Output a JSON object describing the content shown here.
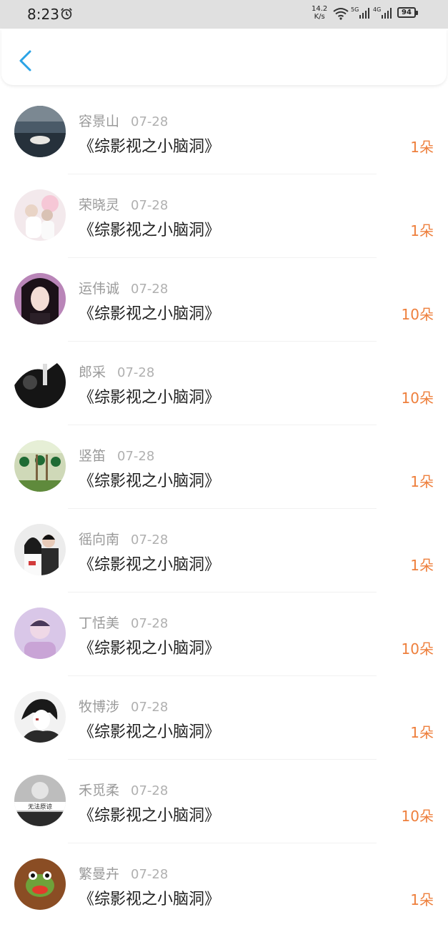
{
  "status_bar": {
    "time": "8:23",
    "net_speed_value": "14.2",
    "net_speed_unit": "K/s",
    "sig1_label": "5G",
    "sig2_label": "4G",
    "battery": "94"
  },
  "colors": {
    "accent": "#2aa3e6",
    "amount": "#ee7f3c",
    "name": "#9a9a9a",
    "title": "#222222"
  },
  "items": [
    {
      "name": "容景山",
      "date": "07-28",
      "title": "《综影视之小脑洞》",
      "amount": "1朵"
    },
    {
      "name": "荣晓灵",
      "date": "07-28",
      "title": "《综影视之小脑洞》",
      "amount": "1朵"
    },
    {
      "name": "运伟诚",
      "date": "07-28",
      "title": "《综影视之小脑洞》",
      "amount": "10朵"
    },
    {
      "name": "郎采",
      "date": "07-28",
      "title": "《综影视之小脑洞》",
      "amount": "10朵"
    },
    {
      "name": "竖笛",
      "date": "07-28",
      "title": "《综影视之小脑洞》",
      "amount": "1朵"
    },
    {
      "name": "徭向南",
      "date": "07-28",
      "title": "《综影视之小脑洞》",
      "amount": "1朵"
    },
    {
      "name": "丁恬美",
      "date": "07-28",
      "title": "《综影视之小脑洞》",
      "amount": "10朵"
    },
    {
      "name": "牧博涉",
      "date": "07-28",
      "title": "《综影视之小脑洞》",
      "amount": "1朵"
    },
    {
      "name": "禾觅柔",
      "date": "07-28",
      "title": "《综影视之小脑洞》",
      "amount": "10朵",
      "avatar_caption": "无法原谅"
    },
    {
      "name": "繁曼卉",
      "date": "07-28",
      "title": "《综影视之小脑洞》",
      "amount": "1朵"
    }
  ]
}
